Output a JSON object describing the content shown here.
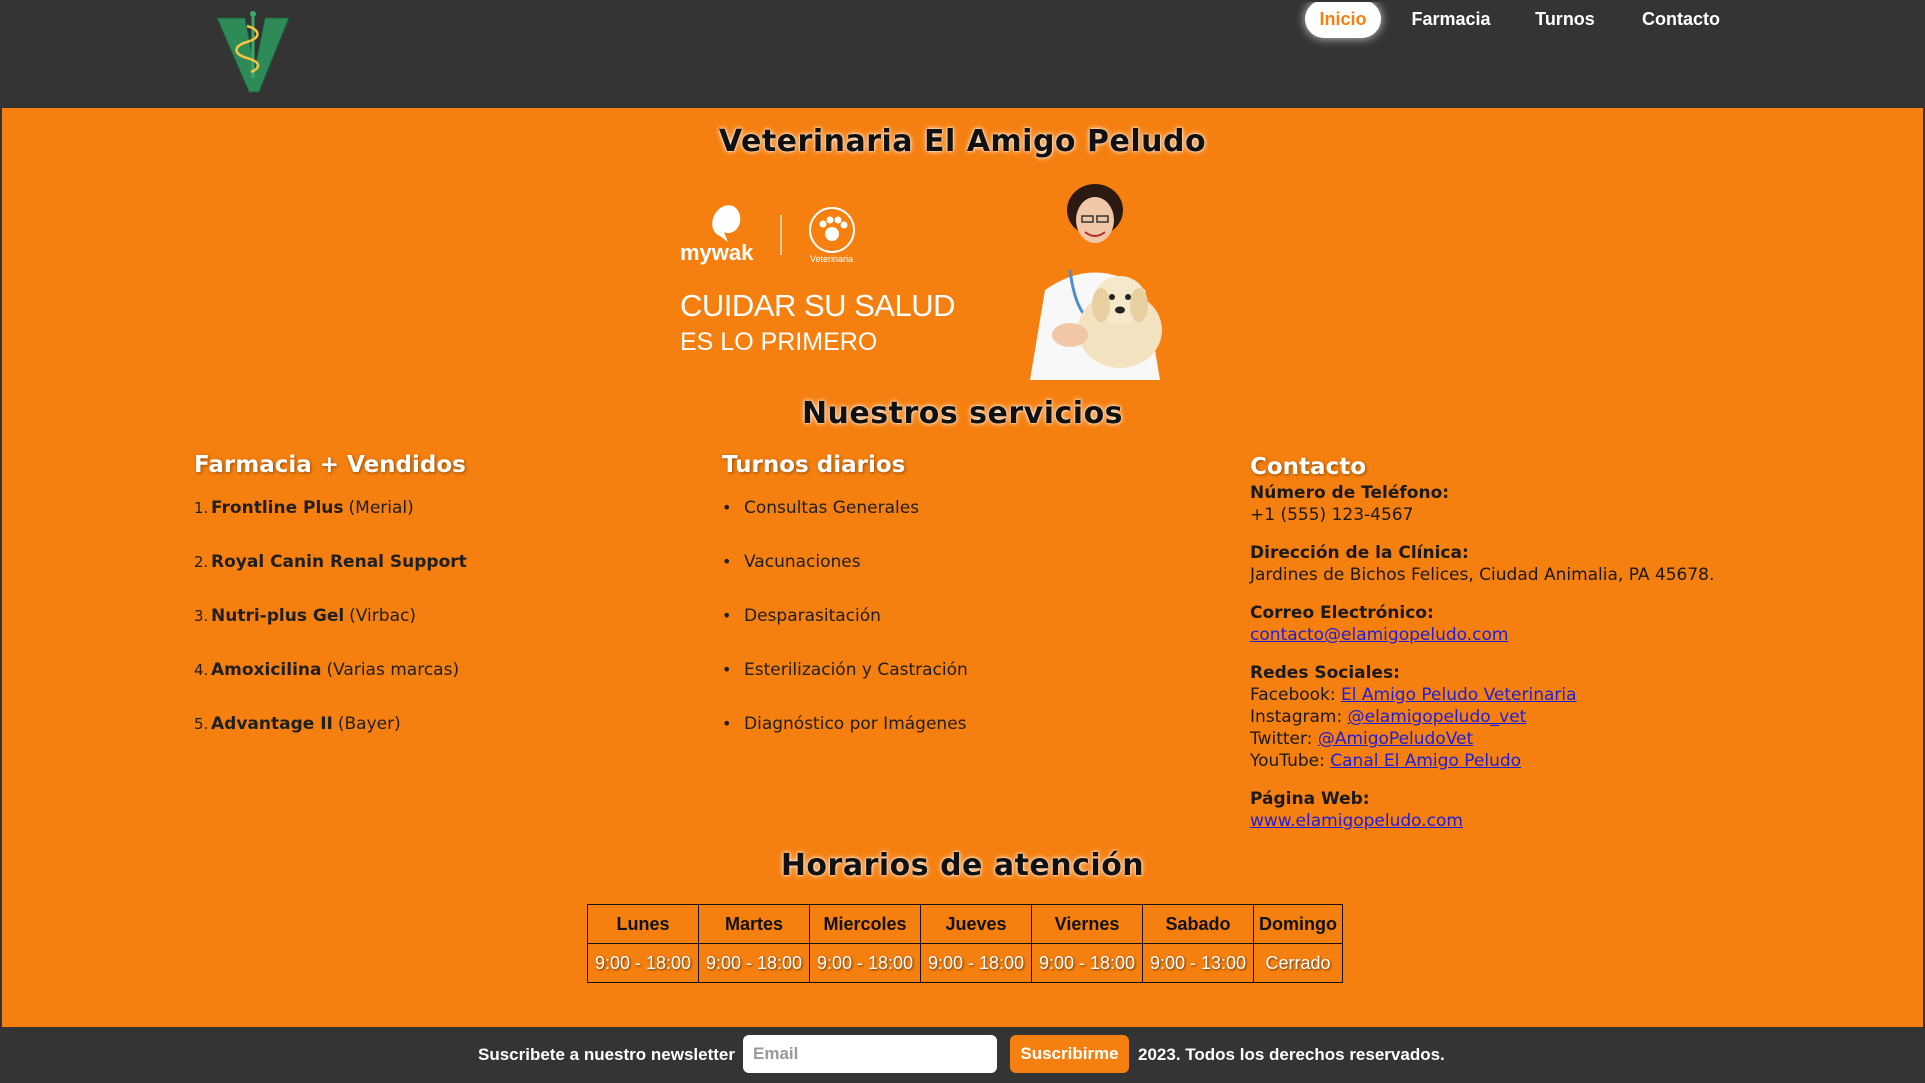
{
  "header": {
    "nav": [
      {
        "label": "Inicio"
      },
      {
        "label": "Farmacia"
      },
      {
        "label": "Turnos"
      },
      {
        "label": "Contacto"
      }
    ]
  },
  "main": {
    "title": "Veterinaria El Amigo Peludo",
    "banner": {
      "brand": "mywak",
      "brand_sub": "Veterinaria",
      "line1": "CUIDAR SU SALUD",
      "line2": "ES LO PRIMERO"
    },
    "services_title": "Nuestros servicios",
    "farmacia": {
      "title": "Farmacia + Vendidos",
      "items": [
        {
          "num": "1.",
          "name": "Frontline Plus",
          "note": "(Merial)"
        },
        {
          "num": "2.",
          "name": "Royal Canin Renal Support",
          "note": ""
        },
        {
          "num": "3.",
          "name": "Nutri-plus Gel",
          "note": "(Virbac)"
        },
        {
          "num": "4.",
          "name": "Amoxicilina",
          "note": "(Varias marcas)"
        },
        {
          "num": "5.",
          "name": "Advantage II",
          "note": "(Bayer)"
        }
      ]
    },
    "turnos": {
      "title": "Turnos diarios",
      "items": [
        {
          "label": "Consultas Generales"
        },
        {
          "label": "Vacunaciones"
        },
        {
          "label": "Desparasitación"
        },
        {
          "label": "Esterilización y Castración"
        },
        {
          "label": "Diagnóstico por Imágenes"
        }
      ]
    },
    "contacto": {
      "title": "Contacto",
      "phone_label": "Número de Teléfono:",
      "phone": "+1 (555) 123-4567",
      "address_label": "Dirección de la Clínica:",
      "address": "Jardines de Bichos Felices, Ciudad Animalia, PA 45678.",
      "email_label": "Correo Electrónico:",
      "email": "contacto@elamigopeludo.com",
      "social_label": "Redes Sociales:",
      "social": [
        {
          "network": "Facebook:",
          "handle": "El Amigo Peludo Veterinaria"
        },
        {
          "network": "Instagram:",
          "handle": "@elamigopeludo_vet"
        },
        {
          "network": "Twitter:",
          "handle": "@AmigoPeludoVet"
        },
        {
          "network": "YouTube:",
          "handle": "Canal El Amigo Peludo"
        }
      ],
      "web_label": "Página Web:",
      "web": "www.elamigopeludo.com"
    },
    "horarios_title": "Horarios de atención",
    "horarios": {
      "days": [
        "Lunes",
        "Martes",
        "Miercoles",
        "Jueves",
        "Viernes",
        "Sabado",
        "Domingo"
      ],
      "hours": [
        "9:00 - 18:00",
        "9:00 - 18:00",
        "9:00 - 18:00",
        "9:00 - 18:00",
        "9:00 - 18:00",
        "9:00 - 13:00",
        "Cerrado"
      ]
    }
  },
  "footer": {
    "newsletter_label": "Suscribete a nuestro newsletter",
    "email_placeholder": "Email",
    "subscribe_label": "Suscribirme",
    "copyright": "2023. Todos los derechos reservados."
  },
  "colors": {
    "background": "#f57f0f",
    "header": "#343434",
    "accent": "#f57f0f",
    "logo_green": "#2e8b57"
  }
}
